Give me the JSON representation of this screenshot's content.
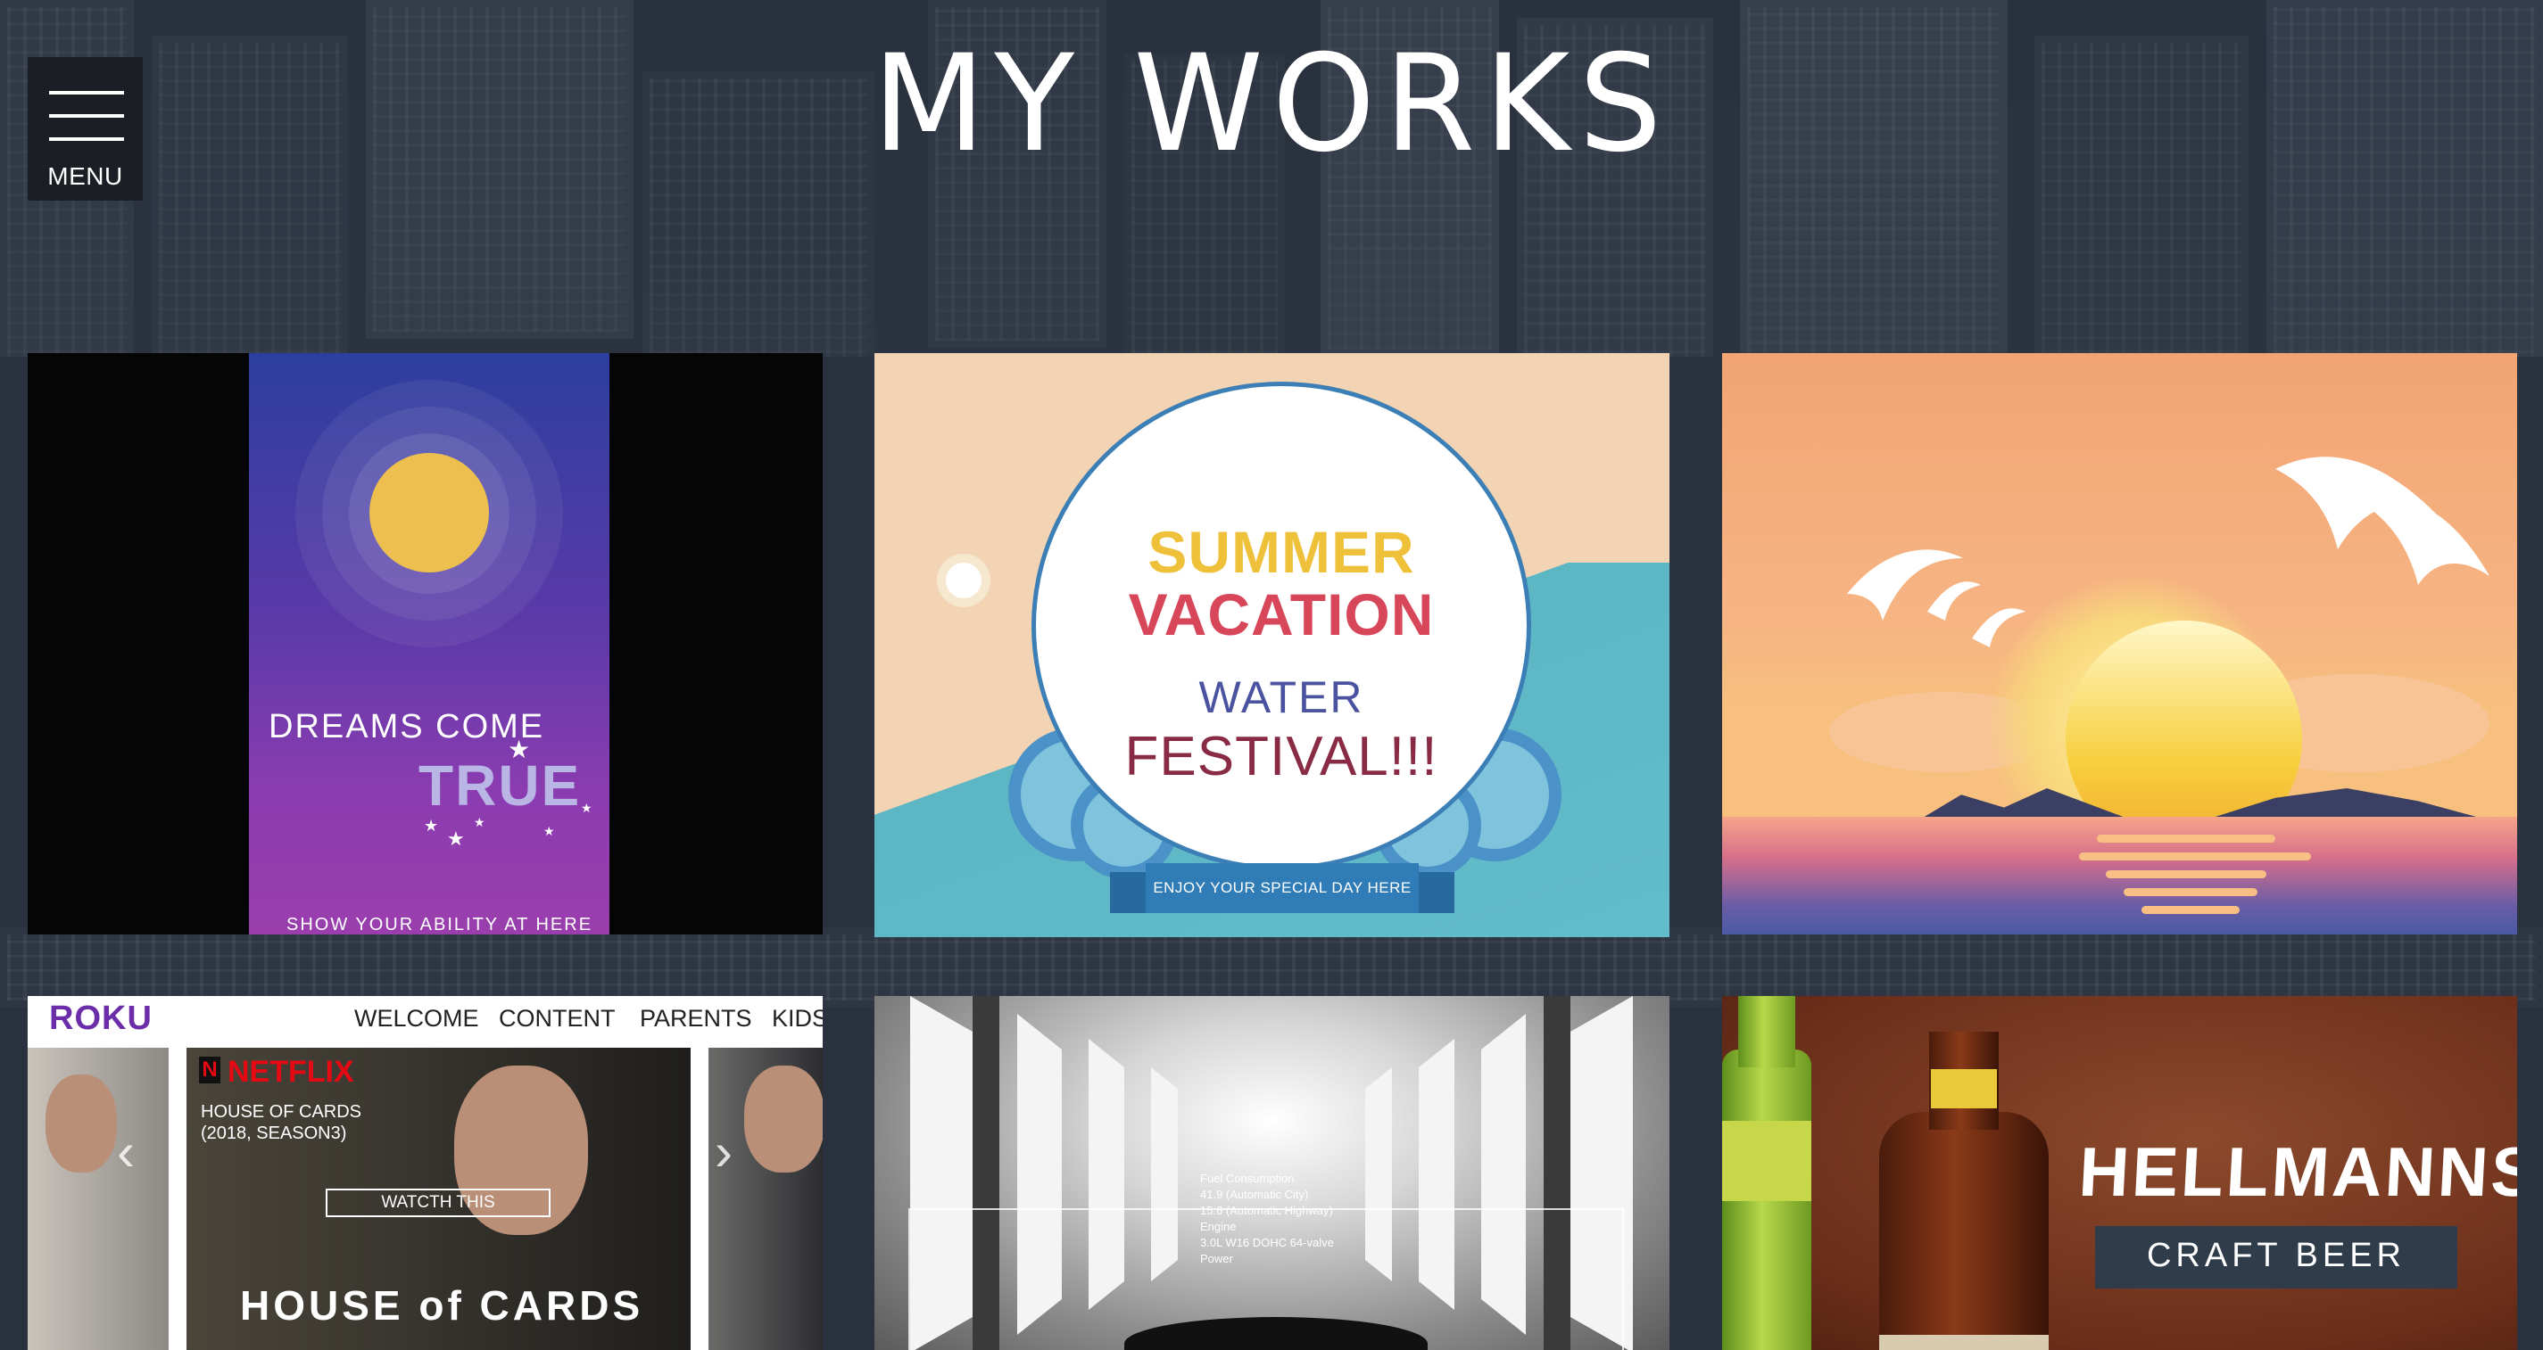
{
  "header": {
    "menu_label": "MENU",
    "title": "MY WORKS"
  },
  "works": [
    {
      "name": "dreams-come-true",
      "line1": "DREAMS COME",
      "line2": "TRUE",
      "footer": "SHOW YOUR ABILITY AT HERE"
    },
    {
      "name": "summer-vacation",
      "line1": "SUMMER",
      "line2": "VACATION",
      "line3": "WATER",
      "line4": "FESTIVAL!!!",
      "ribbon": "ENJOY YOUR SPECIAL DAY HERE"
    },
    {
      "name": "sunset-illustration"
    },
    {
      "name": "roku-netflix",
      "brand": "ROKU",
      "nav": [
        "WELCOME",
        "CONTENT",
        "PARENTS",
        "KIDS"
      ],
      "service": "NETFLIX",
      "show_title": "HOUSE OF CARDS",
      "show_meta": "(2018, SEASON3)",
      "cta": "WATCTH THIS",
      "logo_text": "HOUSE of CARDS"
    },
    {
      "name": "car-tunnel",
      "specs": [
        "Fuel Consumption",
        "41.9 (Automatic City)",
        "15.6 (Automatic Highway)",
        "Engine",
        "3.0L W16 DOHC 64-valve",
        "Power"
      ]
    },
    {
      "name": "hellmanns-beer",
      "brand": "HELLMANNS",
      "subtitle": "CRAFT BEER"
    }
  ],
  "colors": {
    "background": "#2b3340",
    "menu_bg": "#1b1e24",
    "roku_purple": "#6c2ea8",
    "netflix_red": "#e50914"
  }
}
